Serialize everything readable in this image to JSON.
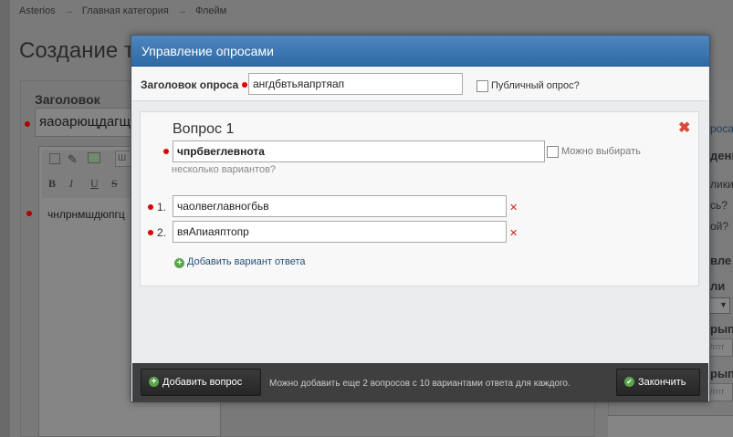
{
  "background": {
    "breadcrumbs": [
      "Asterios",
      "Главная категория",
      "Флейм"
    ],
    "breadcrumb_separator": "→",
    "page_title": "Создание т",
    "form": {
      "title_label": "Заголовок",
      "title_value": "яаоарющдагщ",
      "editor_text": "чнлрнмшдюпгц"
    },
    "right_column": {
      "poll_link": "росами",
      "section_1": "дения",
      "q1": "лики?",
      "q2": "сь?",
      "q3": "ой?",
      "section_2": "вле",
      "section_3": "ли",
      "section_4": "рыпи",
      "section_5": "рыпи",
      "date_placeholder": "/гггг"
    }
  },
  "modal": {
    "title": "Управление опросами",
    "poll_title_label": "Заголовок опроса",
    "poll_title_value": "ангдбвтьяапртяап",
    "public_label": "Публичный опрос?",
    "question": {
      "title": "Вопрос 1",
      "value": "чпрбвеглевнота",
      "multi_label": "Можно выбирать",
      "multi_hint": "несколько вариантов?",
      "options": [
        {
          "num": "1.",
          "value": "чаолвеглавногбьв"
        },
        {
          "num": "2.",
          "value": "вяАпиаяптопр"
        }
      ],
      "add_option_label": "Добавить вариант ответа"
    },
    "footer": {
      "add_question_label": "Добавить вопрос",
      "note": "Можно добавить еще 2 вопросов с 10 вариантами ответа для каждого.",
      "finish_label": "Закончить"
    }
  },
  "colors": {
    "header_blue": "#2f6aa5",
    "required_red": "#e00000",
    "delete_red": "#d84a3c",
    "plus_green": "#5aa64b",
    "footer_dark": "#3f3f3f"
  }
}
